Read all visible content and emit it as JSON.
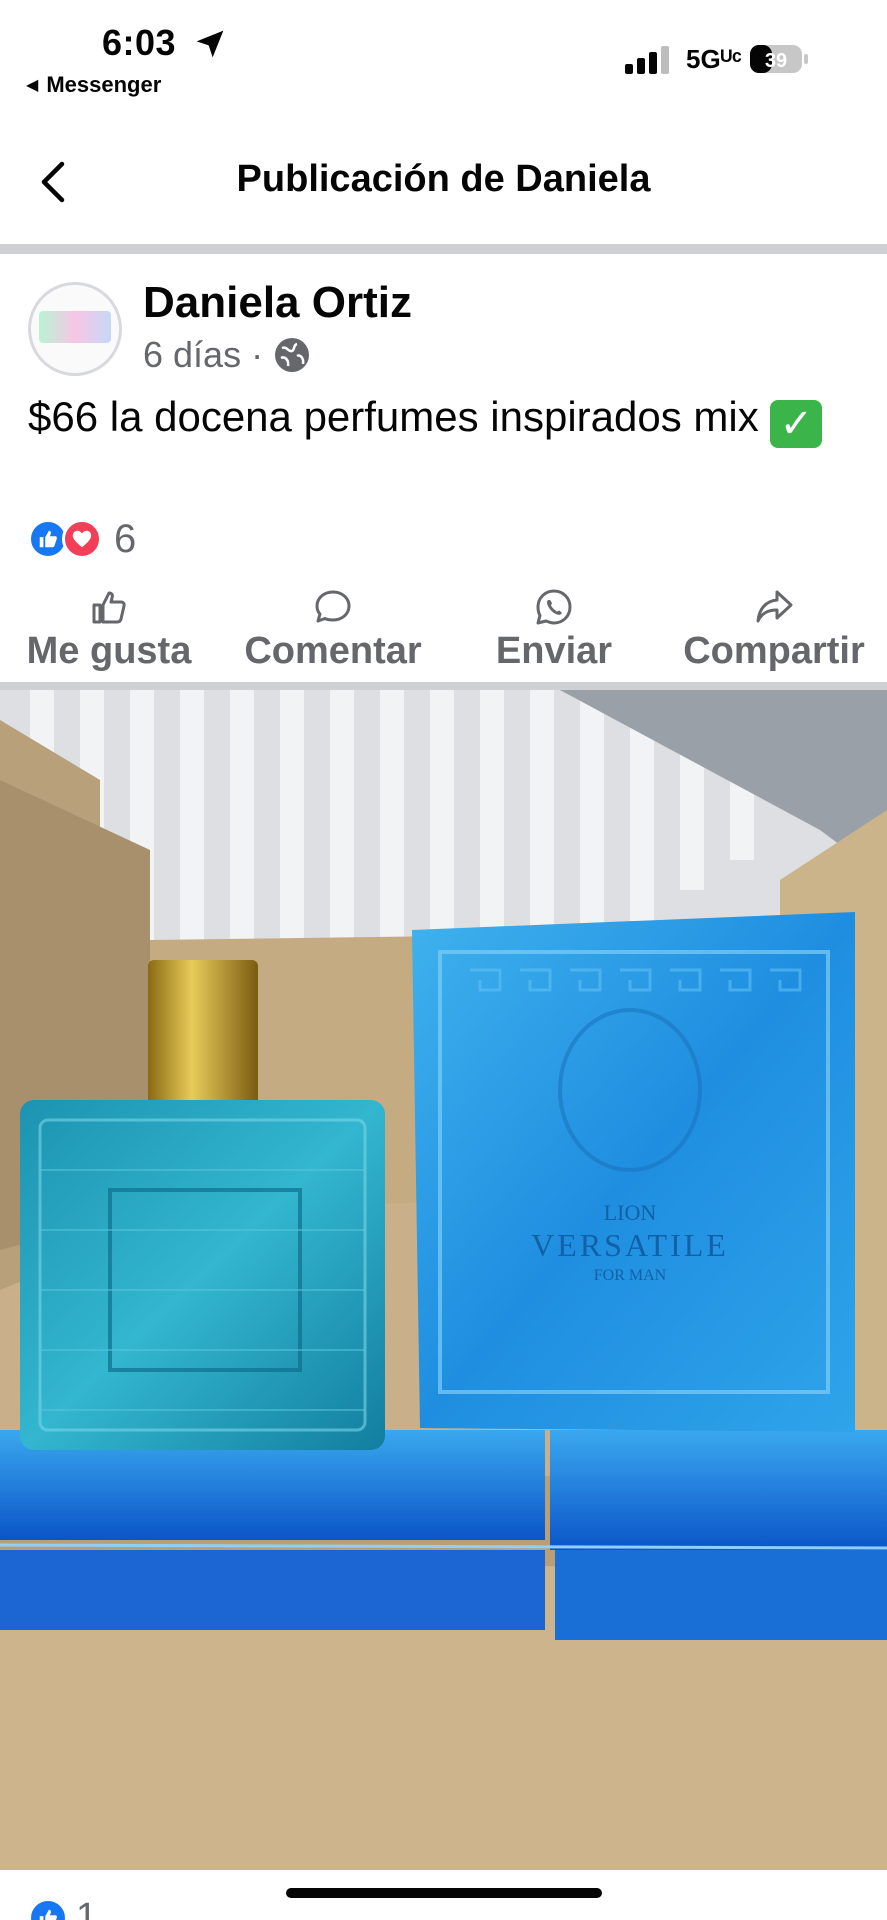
{
  "status_bar": {
    "time": "6:03",
    "back_app": "Messenger",
    "network": "5Gᵁᶜ",
    "battery": "39"
  },
  "header": {
    "title": "Publicación de Daniela"
  },
  "post": {
    "author": "Daniela Ortiz",
    "time_ago": "6 días",
    "separator": "·",
    "text": "$66 la docena perfumes inspirados mix",
    "reaction_count": "6"
  },
  "actions": {
    "like": "Me gusta",
    "comment": "Comentar",
    "send": "Enviar",
    "share": "Compartir"
  },
  "photo": {
    "box_brand": "LION",
    "box_name": "VERSATILE",
    "box_sub": "FOR MAN"
  },
  "next_reaction_count": "1",
  "colors": {
    "facebook_blue": "#1877f2",
    "love_red": "#f33e58",
    "secondary_text": "#65676b"
  }
}
